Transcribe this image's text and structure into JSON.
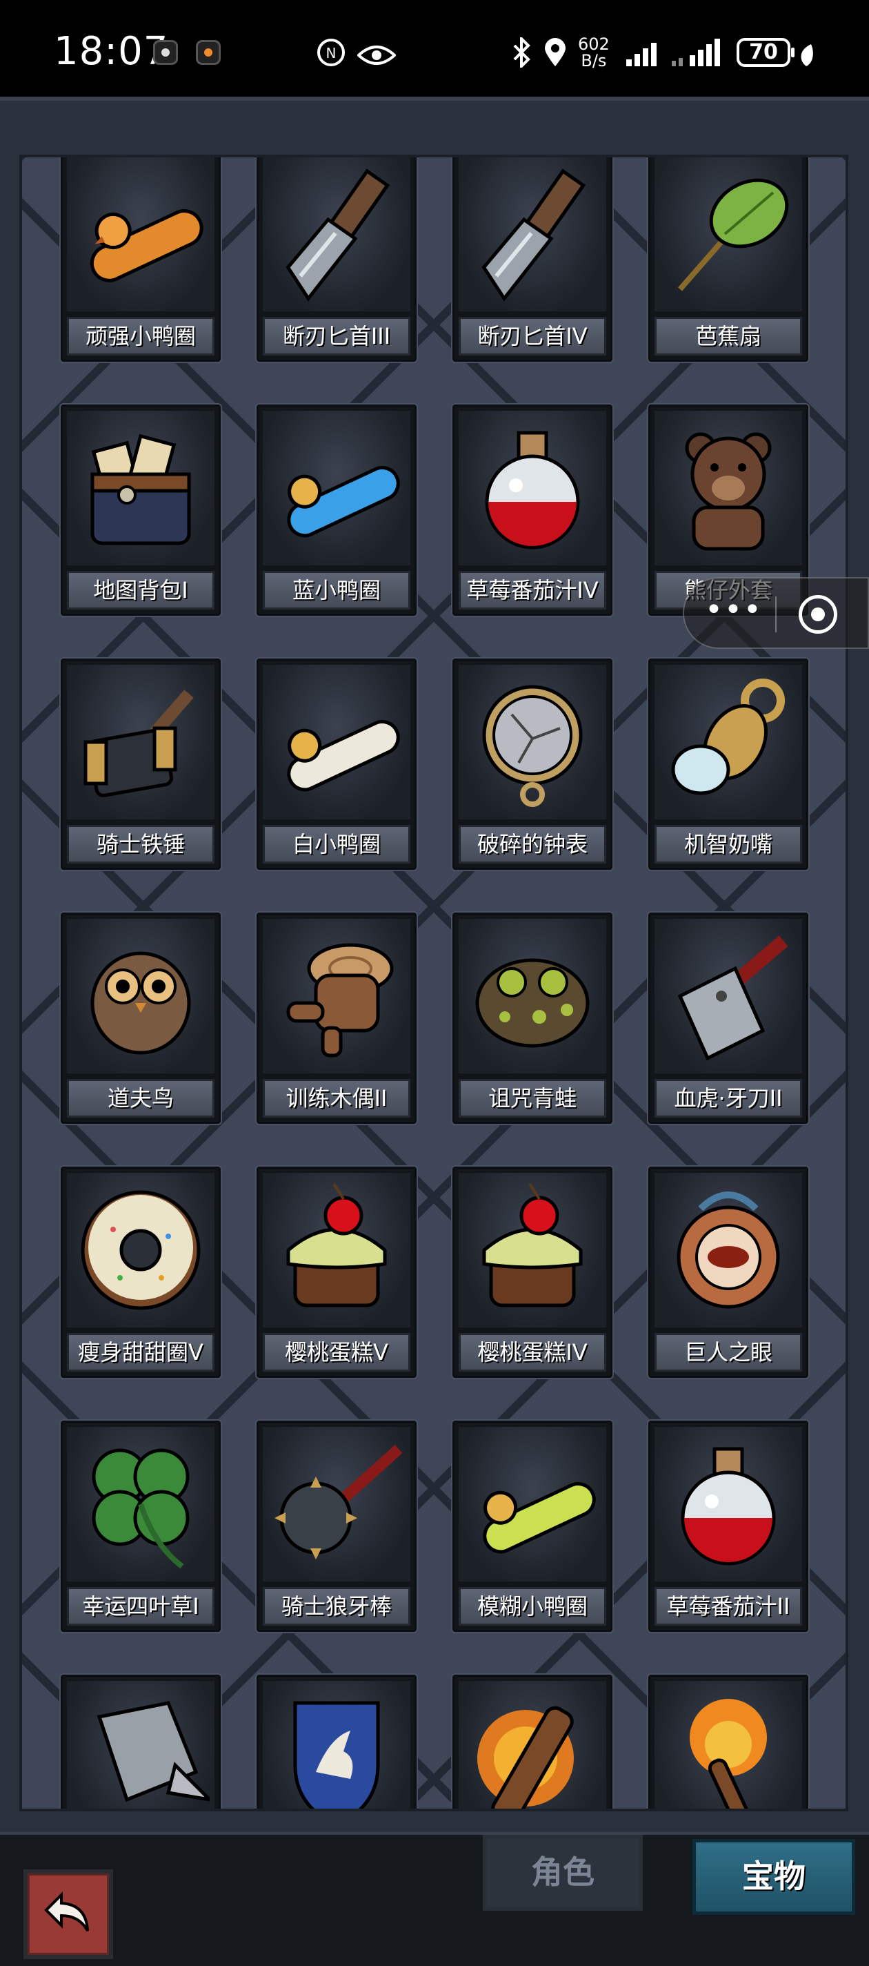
{
  "status_bar": {
    "time": "18:07",
    "net_speed_value": "602",
    "net_speed_unit": "B/s",
    "battery": "70",
    "icons": [
      "notification-icon",
      "notification-icon",
      "nfc-icon",
      "eye-icon",
      "bluetooth-icon",
      "location-icon",
      "signal-icon",
      "signal-icon",
      "leaf-icon"
    ]
  },
  "items": [
    {
      "label": "顽强小鸭圈",
      "icon": "orange-duck-ring-icon"
    },
    {
      "label": "断刃匕首III",
      "icon": "broken-dagger-icon"
    },
    {
      "label": "断刃匕首IV",
      "icon": "broken-dagger-icon"
    },
    {
      "label": "芭蕉扇",
      "icon": "banana-leaf-fan-icon"
    },
    {
      "label": "地图背包I",
      "icon": "map-backpack-icon"
    },
    {
      "label": "蓝小鸭圈",
      "icon": "blue-duck-ring-icon"
    },
    {
      "label": "草莓番茄汁IV",
      "icon": "red-potion-icon"
    },
    {
      "label": "熊仔外套",
      "icon": "teddy-bear-icon"
    },
    {
      "label": "骑士铁锤",
      "icon": "knight-hammer-icon"
    },
    {
      "label": "白小鸭圈",
      "icon": "white-duck-ring-icon"
    },
    {
      "label": "破碎的钟表",
      "icon": "broken-pocket-watch-icon"
    },
    {
      "label": "机智奶嘴",
      "icon": "pacifier-icon"
    },
    {
      "label": "道夫鸟",
      "icon": "owl-icon"
    },
    {
      "label": "训练木偶II",
      "icon": "wooden-dummy-icon"
    },
    {
      "label": "诅咒青蛙",
      "icon": "cursed-frog-icon"
    },
    {
      "label": "血虎·牙刀II",
      "icon": "cleaver-icon"
    },
    {
      "label": "瘦身甜甜圈V",
      "icon": "donut-icon"
    },
    {
      "label": "樱桃蛋糕V",
      "icon": "cherry-cake-icon"
    },
    {
      "label": "樱桃蛋糕IV",
      "icon": "cherry-cake-icon"
    },
    {
      "label": "巨人之眼",
      "icon": "giant-eye-amulet-icon"
    },
    {
      "label": "幸运四叶草I",
      "icon": "four-leaf-clover-icon"
    },
    {
      "label": "骑士狼牙棒",
      "icon": "spiked-mace-icon"
    },
    {
      "label": "模糊小鸭圈",
      "icon": "yellow-duck-ring-icon"
    },
    {
      "label": "草莓番茄汁II",
      "icon": "red-potion-icon"
    },
    {
      "label": "",
      "icon": "knight-gauntlet-icon"
    },
    {
      "label": "",
      "icon": "unicorn-shield-icon"
    },
    {
      "label": "",
      "icon": "flaming-club-icon"
    },
    {
      "label": "",
      "icon": "flaming-torch-icon"
    }
  ],
  "tabs": {
    "role": "角色",
    "treasure": "宝物"
  },
  "colors": {
    "active_tab": "#2f6f87",
    "back_button": "#9a3a36"
  }
}
